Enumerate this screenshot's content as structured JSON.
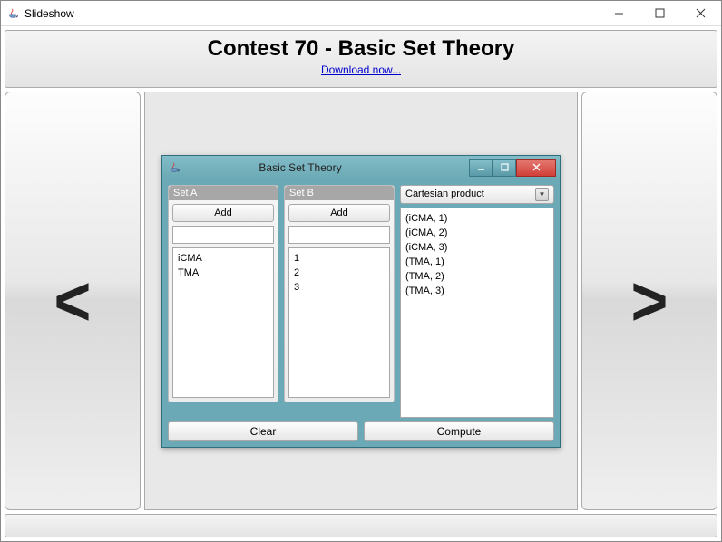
{
  "outer_window": {
    "title": "Slideshow"
  },
  "header": {
    "title": "Contest 70 - Basic Set Theory",
    "download_link": "Download now..."
  },
  "nav": {
    "prev": "<",
    "next": ">"
  },
  "inner_window": {
    "title": "Basic Set Theory",
    "set_a": {
      "label": "Set A",
      "add_label": "Add",
      "input_value": "",
      "items": [
        "iCMA",
        "TMA"
      ]
    },
    "set_b": {
      "label": "Set B",
      "add_label": "Add",
      "input_value": "",
      "items": [
        "1",
        "2",
        "3"
      ]
    },
    "operation": {
      "selected": "Cartesian product"
    },
    "results": [
      "(iCMA, 1)",
      "(iCMA, 2)",
      "(iCMA, 3)",
      "(TMA, 1)",
      "(TMA, 2)",
      "(TMA, 3)"
    ],
    "buttons": {
      "clear": "Clear",
      "compute": "Compute"
    }
  }
}
